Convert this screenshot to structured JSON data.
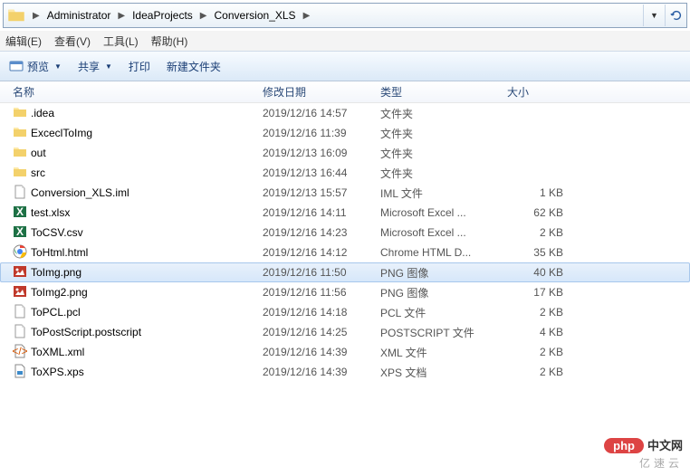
{
  "breadcrumb": {
    "items": [
      "Administrator",
      "IdeaProjects",
      "Conversion_XLS"
    ]
  },
  "menu": {
    "edit": "编辑(E)",
    "view": "查看(V)",
    "tools": "工具(L)",
    "help": "帮助(H)"
  },
  "toolbar": {
    "preview": "预览",
    "share": "共享",
    "print": "打印",
    "newfolder": "新建文件夹"
  },
  "columns": {
    "name": "名称",
    "date": "修改日期",
    "type": "类型",
    "size": "大小"
  },
  "files": [
    {
      "icon": "folder",
      "name": ".idea",
      "date": "2019/12/16 14:57",
      "type": "文件夹",
      "size": ""
    },
    {
      "icon": "folder",
      "name": "ExceclToImg",
      "date": "2019/12/16 11:39",
      "type": "文件夹",
      "size": ""
    },
    {
      "icon": "folder",
      "name": "out",
      "date": "2019/12/13 16:09",
      "type": "文件夹",
      "size": ""
    },
    {
      "icon": "folder",
      "name": "src",
      "date": "2019/12/13 16:44",
      "type": "文件夹",
      "size": ""
    },
    {
      "icon": "file",
      "name": "Conversion_XLS.iml",
      "date": "2019/12/13 15:57",
      "type": "IML 文件",
      "size": "1 KB"
    },
    {
      "icon": "excel",
      "name": "test.xlsx",
      "date": "2019/12/16 14:11",
      "type": "Microsoft Excel ...",
      "size": "62 KB"
    },
    {
      "icon": "excel",
      "name": "ToCSV.csv",
      "date": "2019/12/16 14:23",
      "type": "Microsoft Excel ...",
      "size": "2 KB"
    },
    {
      "icon": "chrome",
      "name": "ToHtml.html",
      "date": "2019/12/16 14:12",
      "type": "Chrome HTML D...",
      "size": "35 KB"
    },
    {
      "icon": "image",
      "name": "ToImg.png",
      "date": "2019/12/16 11:50",
      "type": "PNG 图像",
      "size": "40 KB",
      "selected": true
    },
    {
      "icon": "image",
      "name": "ToImg2.png",
      "date": "2019/12/16 11:56",
      "type": "PNG 图像",
      "size": "17 KB"
    },
    {
      "icon": "file",
      "name": "ToPCL.pcl",
      "date": "2019/12/16 14:18",
      "type": "PCL 文件",
      "size": "2 KB"
    },
    {
      "icon": "file",
      "name": "ToPostScript.postscript",
      "date": "2019/12/16 14:25",
      "type": "POSTSCRIPT 文件",
      "size": "4 KB"
    },
    {
      "icon": "xml",
      "name": "ToXML.xml",
      "date": "2019/12/16 14:39",
      "type": "XML 文件",
      "size": "2 KB"
    },
    {
      "icon": "xps",
      "name": "ToXPS.xps",
      "date": "2019/12/16 14:39",
      "type": "XPS 文档",
      "size": "2 KB"
    }
  ],
  "watermark": {
    "php": "php",
    "cn": "中文网",
    "sub": "亿速云"
  }
}
